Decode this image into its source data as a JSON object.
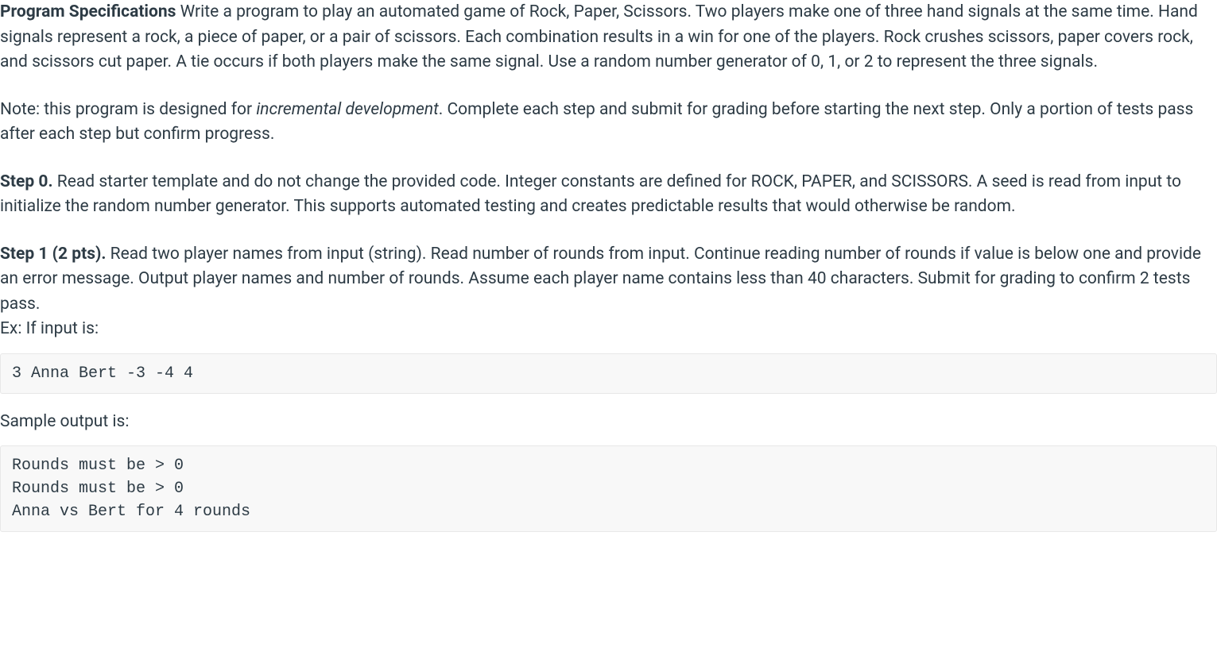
{
  "spec": {
    "heading_label": "Program Specifications",
    "intro_text": " Write a program to play an automated game of Rock, Paper, Scissors. Two players make one of three hand signals at the same time. Hand signals represent a rock, a piece of paper, or a pair of scissors. Each combination results in a win for one of the players. Rock crushes scissors, paper covers rock, and scissors cut paper. A tie occurs if both players make the same signal. Use a random number generator of 0, 1, or 2 to represent the three signals."
  },
  "note": {
    "prefix": "Note: this program is designed for ",
    "italic": "incremental development",
    "suffix": ". Complete each step and submit for grading before starting the next step. Only a portion of tests pass after each step but confirm progress."
  },
  "step0": {
    "label": "Step 0.",
    "text": " Read starter template and do not change the provided code. Integer constants are defined for ROCK, PAPER, and SCISSORS. A seed is read from input to initialize the random number generator. This supports automated testing and creates predictable results that would otherwise be random."
  },
  "step1": {
    "label": "Step 1 (2 pts).",
    "text": " Read two player names from input (string). Read number of rounds from input. Continue reading number of rounds if value is below one and provide an error message. Output player names and number of rounds. Assume each player name contains less than 40 characters. Submit for grading to confirm 2 tests pass.",
    "example_label": "Ex: If input is:",
    "example_input": "3 Anna Bert -3 -4 4",
    "sample_output_label": "Sample output is:",
    "sample_output": "Rounds must be > 0\nRounds must be > 0\nAnna vs Bert for 4 rounds"
  }
}
